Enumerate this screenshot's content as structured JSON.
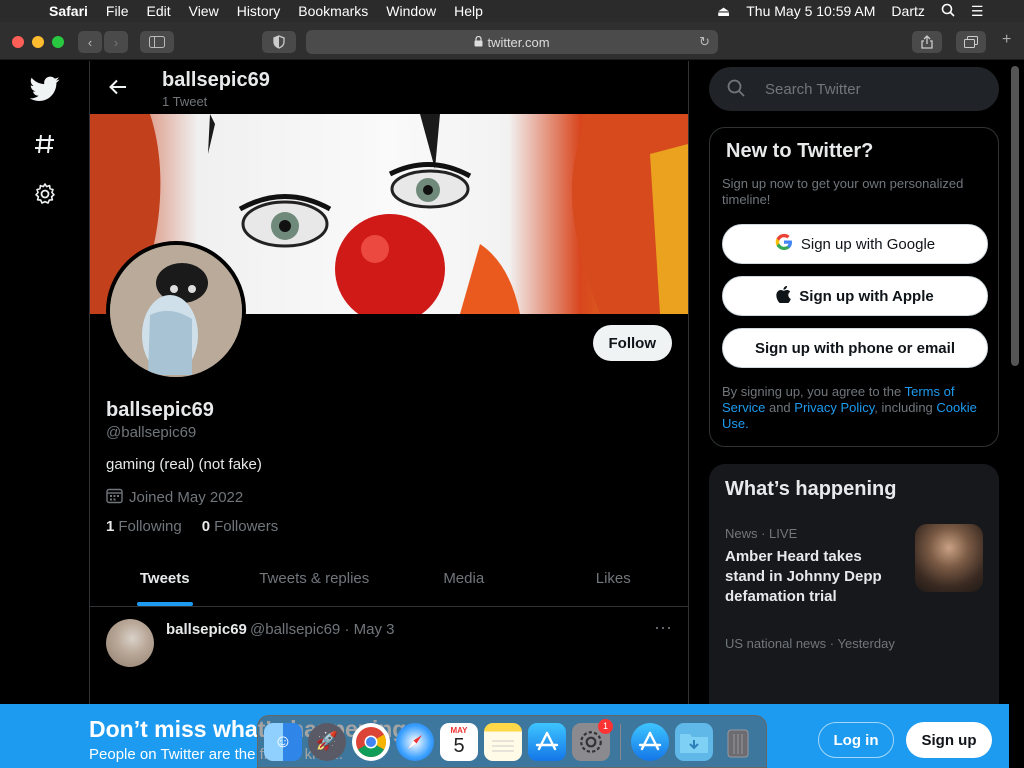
{
  "menubar": {
    "app": "Safari",
    "items": [
      "File",
      "Edit",
      "View",
      "History",
      "Bookmarks",
      "Window",
      "Help"
    ],
    "datetime": "Thu May 5  10:59 AM",
    "user": "Dartz"
  },
  "browser": {
    "url": "twitter.com"
  },
  "profile": {
    "title_name": "ballsepic69",
    "tweet_count": "1 Tweet",
    "name": "ballsepic69",
    "handle": "@ballsepic69",
    "bio": "gaming (real) (not fake)",
    "joined": "Joined May 2022",
    "following_count": "1",
    "following_label": "Following",
    "followers_count": "0",
    "followers_label": "Followers",
    "follow_label": "Follow"
  },
  "tabs": [
    "Tweets",
    "Tweets & replies",
    "Media",
    "Likes"
  ],
  "tweet": {
    "name": "ballsepic69",
    "meta": "@ballsepic69 · May 3",
    "more": "···"
  },
  "search": {
    "placeholder": "Search Twitter"
  },
  "new_to_twitter": {
    "title": "New to Twitter?",
    "subtitle": "Sign up now to get your own personalized timeline!",
    "google": "Sign up with Google",
    "apple": "Sign up with Apple",
    "phone": "Sign up with phone or email",
    "terms_prefix": "By signing up, you agree to the ",
    "terms_link": "Terms of Service",
    "terms_and": " and ",
    "privacy_link": "Privacy Policy",
    "terms_including": ", including ",
    "cookie_link": "Cookie Use",
    "terms_end": "."
  },
  "happening": {
    "title": "What’s happening",
    "category": "News · LIVE",
    "headline": "Amber Heard takes stand in Johnny Depp defamation trial",
    "category2": "US national news · Yesterday"
  },
  "bottom_bar": {
    "title": "Don’t miss what’s happening",
    "subtitle": "People on Twitter are the first to know.",
    "login": "Log in",
    "signup": "Sign up"
  },
  "dock": {
    "settings_badge": "1",
    "calendar_month": "MAY",
    "calendar_day": "5"
  },
  "colors": {
    "accent": "#1d9bf0",
    "background": "#000000",
    "muted": "#71767b"
  }
}
